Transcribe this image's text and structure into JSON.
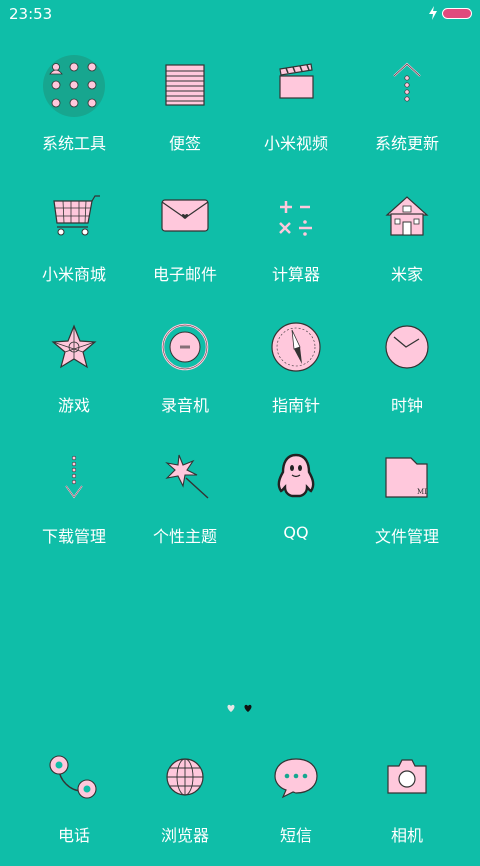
{
  "status_bar": {
    "time": "23:53",
    "battery_color": "#e04a7d",
    "icons": [
      "charging-icon",
      "battery-icon"
    ]
  },
  "grid": [
    {
      "label": "系统工具",
      "icon": "system-tools-icon"
    },
    {
      "label": "便签",
      "icon": "notes-icon"
    },
    {
      "label": "小米视频",
      "icon": "video-clapper-icon"
    },
    {
      "label": "系统更新",
      "icon": "system-update-icon"
    },
    {
      "label": "小米商城",
      "icon": "shopping-cart-icon"
    },
    {
      "label": "电子邮件",
      "icon": "envelope-icon"
    },
    {
      "label": "计算器",
      "icon": "calculator-icon"
    },
    {
      "label": "米家",
      "icon": "house-icon"
    },
    {
      "label": "游戏",
      "icon": "star-game-icon"
    },
    {
      "label": "录音机",
      "icon": "recorder-icon"
    },
    {
      "label": "指南针",
      "icon": "compass-icon"
    },
    {
      "label": "时钟",
      "icon": "clock-icon"
    },
    {
      "label": "下载管理",
      "icon": "download-arrow-icon"
    },
    {
      "label": "个性主题",
      "icon": "magic-wand-icon"
    },
    {
      "label": "QQ",
      "icon": "qq-penguin-icon"
    },
    {
      "label": "文件管理",
      "icon": "file-manager-icon"
    }
  ],
  "page_indicator": {
    "total": 2,
    "current": 1
  },
  "dock": [
    {
      "label": "电话",
      "icon": "phone-icon"
    },
    {
      "label": "浏览器",
      "icon": "globe-icon"
    },
    {
      "label": "短信",
      "icon": "message-bubble-icon"
    },
    {
      "label": "相机",
      "icon": "camera-icon"
    }
  ],
  "colors": {
    "background": "#0fbea8",
    "icon_fill": "#ffc8dc",
    "icon_stroke": "#333333"
  }
}
